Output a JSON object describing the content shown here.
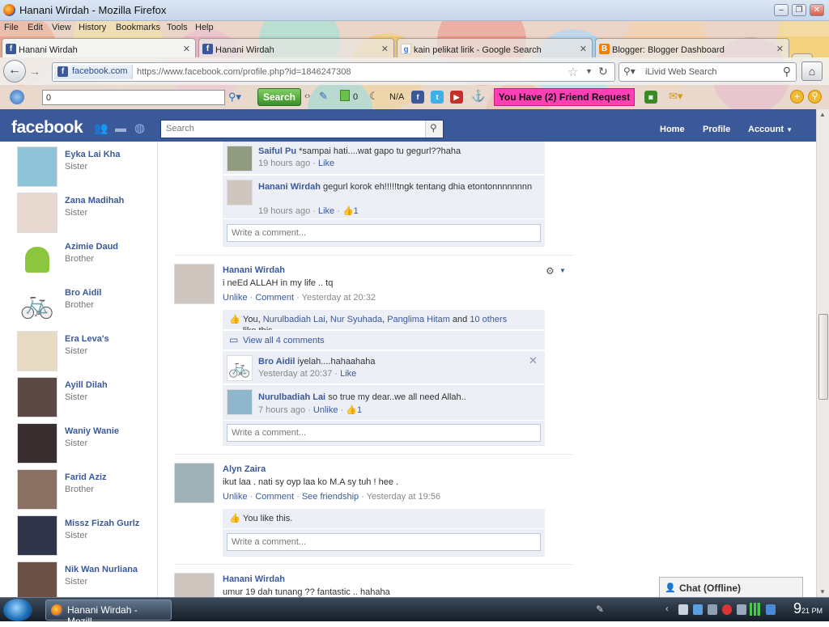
{
  "window": {
    "title": "Hanani Wirdah - Mozilla Firefox"
  },
  "menu": [
    "File",
    "Edit",
    "View",
    "History",
    "Bookmarks",
    "Tools",
    "Help"
  ],
  "tabs": [
    {
      "label": "Hanani Wirdah"
    },
    {
      "label": "Hanani Wirdah"
    },
    {
      "label": "kain pelikat lirik - Google Search"
    },
    {
      "label": "Blogger: Blogger Dashboard"
    }
  ],
  "nav": {
    "site_identity": "facebook.com",
    "url": "https://www.facebook.com/profile.php?id=1846247308",
    "search_placeholder": "iLivid Web Search"
  },
  "toolbar": {
    "input_value": "0",
    "search_label": "Search",
    "counter": "0",
    "na": "N/A",
    "friend_request": "You Have (2) Friend Request"
  },
  "fb": {
    "logo": "facebook",
    "search_placeholder": "Search",
    "nav": {
      "home": "Home",
      "profile": "Profile",
      "account": "Account"
    }
  },
  "family": [
    {
      "name": "Eyka Lai Kha",
      "relation": "Sister"
    },
    {
      "name": "Zana Madihah",
      "relation": "Sister"
    },
    {
      "name": "Azimie Daud",
      "relation": "Brother"
    },
    {
      "name": "Bro Aidil",
      "relation": "Brother"
    },
    {
      "name": "Era Leva's",
      "relation": "Sister"
    },
    {
      "name": "Ayill Dilah",
      "relation": "Sister"
    },
    {
      "name": "Waniy Wanie",
      "relation": "Sister"
    },
    {
      "name": "Farid Aziz",
      "relation": "Brother"
    },
    {
      "name": "Missz Fizah Gurlz",
      "relation": "Sister"
    },
    {
      "name": "Nik Wan Nurliana",
      "relation": "Sister"
    }
  ],
  "top_comments": [
    {
      "author": "Saiful Pu",
      "text": "*sampai hati....wat gapo tu gegurl??haha",
      "time": "19 hours ago",
      "like": "Like"
    },
    {
      "author": "Hanani Wirdah",
      "text": "gegurl korok eh!!!!!tngk tentang dhia etontonnnnnnnn",
      "time": "19 hours ago",
      "like": "Like",
      "likes": "1"
    }
  ],
  "write_comment": "Write a comment...",
  "post1": {
    "author": "Hanani Wirdah",
    "text": "i neEd ALLAH in my life .. tq",
    "unlike": "Unlike",
    "comment": "Comment",
    "time": "Yesterday at 20:32",
    "likes_prefix": "You,",
    "likes_names": [
      "Nurulbadiah Lai",
      "Nur Syuhada",
      "Panglima Hitam"
    ],
    "likes_and": "and",
    "likes_others": "10 others",
    "likes_suffix": "like this.",
    "view_all": "View all 4 comments",
    "comments": [
      {
        "author": "Bro Aidil",
        "text": "iyelah....hahaahaha",
        "time": "Yesterday at 20:37",
        "like": "Like"
      },
      {
        "author": "Nurulbadiah Lai",
        "text": "so true my dear..we all need Allah..",
        "time": "7 hours ago",
        "like": "Unlike",
        "likes": "1"
      }
    ]
  },
  "post2": {
    "author": "Alyn Zaira",
    "text": "ikut laa . nati sy oyp laa ko M.A sy tuh ! hee .",
    "unlike": "Unlike",
    "comment": "Comment",
    "friendship": "See friendship",
    "time": "Yesterday at 19:56",
    "likes": "You like this."
  },
  "post3": {
    "author": "Hanani Wirdah",
    "text": "umur 19 dah tunang ?? fantastic .. hahaha"
  },
  "chat": "Chat (Offline)",
  "taskbar": {
    "app": "Hanani Wirdah - Mozill...",
    "time": "9",
    "ampm": "PM",
    "minute": "21"
  },
  "colors": {
    "facebook_blue": "#3b5998",
    "friend_request_bg": "#ff3fb6",
    "search_green": "#3b8f28"
  }
}
